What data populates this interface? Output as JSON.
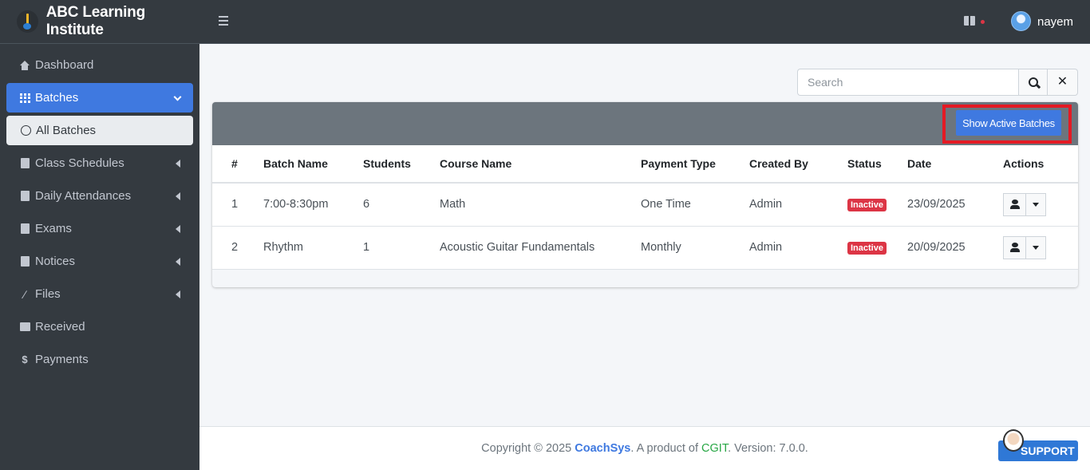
{
  "brand": {
    "name": "ABC Learning Institute"
  },
  "sidebar": {
    "items": [
      {
        "label": "Dashboard"
      },
      {
        "label": "Batches"
      },
      {
        "label": "All Batches"
      },
      {
        "label": "Class Schedules"
      },
      {
        "label": "Daily Attendances"
      },
      {
        "label": "Exams"
      },
      {
        "label": "Notices"
      },
      {
        "label": "Files"
      },
      {
        "label": "Received"
      },
      {
        "label": "Payments"
      }
    ]
  },
  "topbar": {
    "username": "nayem"
  },
  "search": {
    "placeholder": "Search"
  },
  "toolbar": {
    "show_active_label": "Show Active Batches"
  },
  "table": {
    "headers": [
      "#",
      "Batch Name",
      "Students",
      "Course Name",
      "Payment Type",
      "Created By",
      "Status",
      "Date",
      "Actions"
    ],
    "rows": [
      {
        "num": "1",
        "batch": "7:00-8:30pm",
        "students": "6",
        "course": "Math",
        "payment": "One Time",
        "created_by": "Admin",
        "status": "Inactive",
        "date": "23/09/2025"
      },
      {
        "num": "2",
        "batch": "Rhythm",
        "students": "1",
        "course": "Acoustic Guitar Fundamentals",
        "payment": "Monthly",
        "created_by": "Admin",
        "status": "Inactive",
        "date": "20/09/2025"
      }
    ]
  },
  "footer": {
    "prefix": "Copyright © 2025 ",
    "product": "CoachSys",
    "middle": ". A product of ",
    "company": "CGIT",
    "suffix": ". Version: 7.0.0."
  },
  "support": {
    "label": "SUPPORT"
  },
  "colors": {
    "accent": "#3f79e0",
    "danger": "#dc3545",
    "sidebar": "#343a40",
    "highlight": "#e41a24"
  }
}
